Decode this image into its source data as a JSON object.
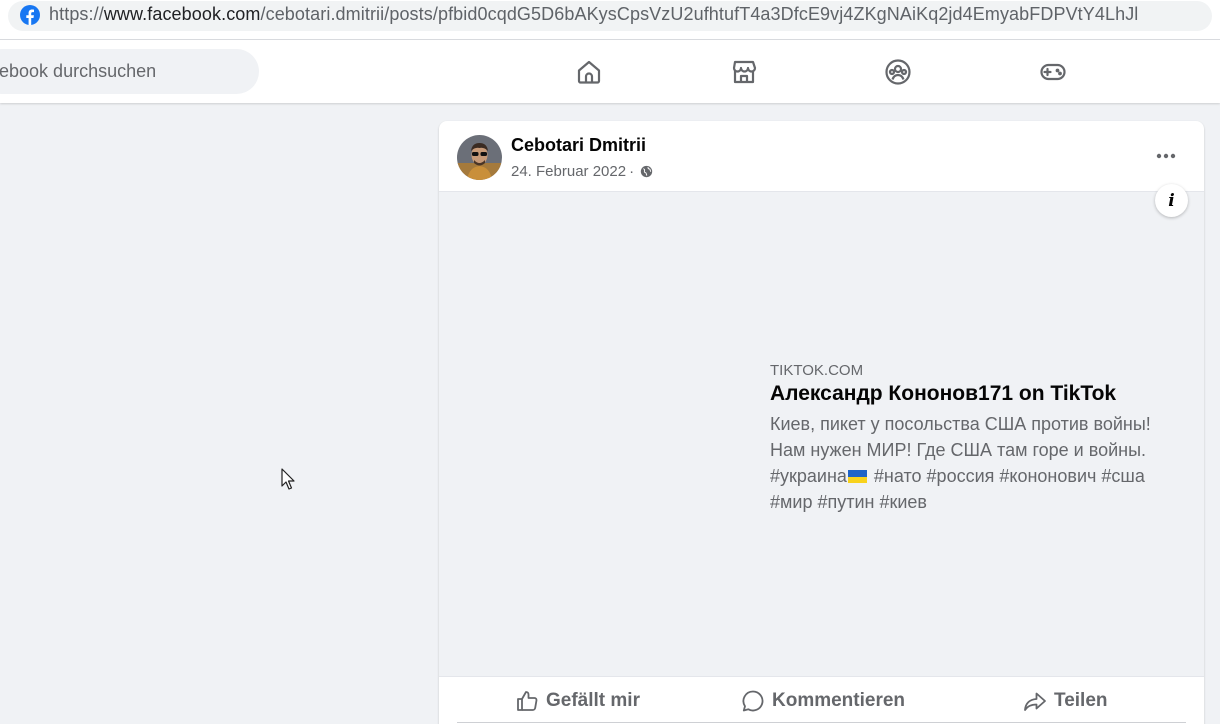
{
  "browser": {
    "url_prefix": "https://",
    "url_host": "www.facebook.com",
    "url_path": "/cebotari.dmitrii/posts/pfbid0cqdG5D6bAKysCpsVzU2ufhtufT4a3DfcE9vj4ZKgNAiKq2jd4EmyabFDPVtY4LhJl"
  },
  "header": {
    "search_placeholder": "acebook durchsuchen",
    "nav": [
      "home-icon",
      "marketplace-icon",
      "groups-icon",
      "gaming-icon"
    ],
    "accent": "#1877f2"
  },
  "post": {
    "author": "Cebotari Dmitrii",
    "date": "24. Februar 2022",
    "separator": "·",
    "privacy_icon": "globe-icon",
    "more_icon": "ellipsis-icon",
    "link": {
      "domain": "TIKTOK.COM",
      "title": "Александр Кононов171 on TikTok",
      "desc_line1": "Киев, пикет у посольства США против войны!",
      "desc_line2": "Нам нужен МИР! Где США там горе и войны.",
      "desc_tag1": "#украина",
      "desc_rest": " #нато #россия #кононович #сша",
      "desc_line4": "#мир #путин #киев"
    },
    "actions": {
      "like": "Gefällt mir",
      "comment": "Kommentieren",
      "share": "Teilen"
    }
  }
}
